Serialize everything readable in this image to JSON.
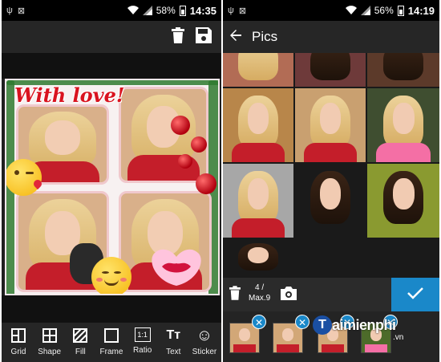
{
  "left_screen": {
    "status": {
      "usb_icon": "usb-icon",
      "signal_x": "no-signal-icon",
      "battery_percent": "58%",
      "time": "14:35"
    },
    "toolbar": {
      "delete_icon": "trash-icon",
      "save_icon": "save-icon"
    },
    "canvas": {
      "title_text": "With love!"
    },
    "tools": [
      {
        "name": "grid",
        "label": "Grid",
        "icon": "grid-icon"
      },
      {
        "name": "shape",
        "label": "Shape",
        "icon": "shape-icon"
      },
      {
        "name": "fill",
        "label": "Fill",
        "icon": "fill-icon"
      },
      {
        "name": "frame",
        "label": "Frame",
        "icon": "frame-icon"
      },
      {
        "name": "ratio",
        "label": "Ratio",
        "icon": "ratio-icon",
        "glyph": "1:1"
      },
      {
        "name": "text",
        "label": "Text",
        "icon": "text-icon",
        "glyph": "Tт"
      },
      {
        "name": "sticker",
        "label": "Sticker",
        "icon": "sticker-icon",
        "glyph": "☺"
      }
    ]
  },
  "right_screen": {
    "status": {
      "battery_percent": "56%",
      "time": "14:19"
    },
    "appbar": {
      "back_icon": "back-arrow-icon",
      "title": "Pics"
    },
    "selection": {
      "count": "4 /",
      "max": "Max.9",
      "confirm_icon": "check-icon",
      "delete_icon": "trash-icon",
      "camera_icon": "camera-icon"
    },
    "watermark": {
      "logo_letter": "T",
      "text": "aimienphi",
      "tld": ".vn"
    }
  },
  "colors": {
    "accent": "#1a88c9",
    "toolbar": "#262626",
    "sweater_red": "#c41e2a"
  }
}
